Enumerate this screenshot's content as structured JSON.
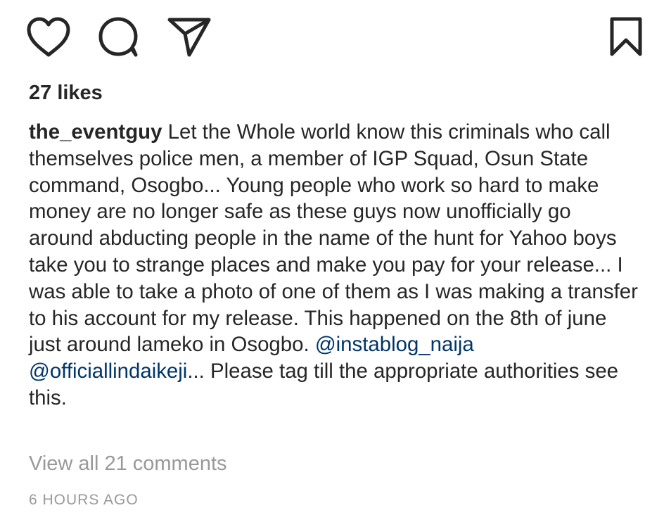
{
  "actions": {
    "like_icon": "heart-outline",
    "comment_icon": "speech-bubble-outline",
    "share_icon": "paper-plane-outline",
    "save_icon": "bookmark-outline"
  },
  "post": {
    "likes": "27 likes",
    "username": "the_eventguy",
    "caption_text": "Let the Whole world know this criminals who call themselves police men,  a member of IGP Squad,  Osun State command,  Osogbo... Young people who work so hard to make money are no longer safe as these guys now unofficially go around abducting people in the name of the hunt for Yahoo boys take you to strange places and make you pay for your release... I was able to take a photo of one of them as I was making a transfer to his account for my release. This happened on the 8th of june just around lameko in Osogbo.",
    "mention_1": "@instablog_naija",
    "mention_2": "@officiallindaikeji",
    "caption_end": "... Please tag till the appropriate authorities see this.",
    "view_comments": "View all 21 comments",
    "timestamp": "6 HOURS AGO"
  },
  "colors": {
    "text": "#262626",
    "mention": "#003569",
    "muted": "#999999"
  }
}
